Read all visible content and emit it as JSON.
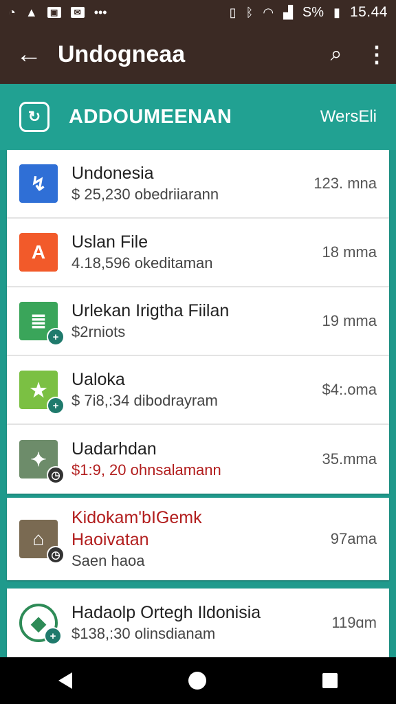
{
  "status": {
    "time": "15.44",
    "battery": "S%"
  },
  "header": {
    "title": "Undogneaa"
  },
  "section": {
    "title": "ADDOUMEENAN",
    "right": "WersEli"
  },
  "list": [
    {
      "title": "Undonesia",
      "subtitle": "$ 25,230 obedriiarann",
      "meta": "123. mna",
      "icon": "messenger-icon",
      "color": "#2f6fd6",
      "glyph": "↯"
    },
    {
      "title": "Uslan File",
      "subtitle": "4.18,596 okeditaman",
      "meta": "18 mma",
      "icon": "letter-a-icon",
      "color": "#f25a2a",
      "glyph": "A"
    },
    {
      "title": "Urlekan Irigtha Fiilan",
      "subtitle": "$2rniots",
      "meta": "19 mma",
      "icon": "sheet-icon",
      "color": "#3aa55a",
      "glyph": "≣"
    },
    {
      "title": "Ualoka",
      "subtitle": "$ 7i8,:34 dibodrayram",
      "meta": "$4:.oma",
      "icon": "star-icon",
      "color": "#7bc043",
      "glyph": "★"
    },
    {
      "title": "Uadarhdan",
      "subtitle": "$1:9, 20 ohnsalamann",
      "meta": "35.mma",
      "icon": "photo-person-icon",
      "color": "#6d8c6a",
      "glyph": "🚶"
    },
    {
      "title": "Kidokam'bIGemk",
      "title2": "Haoivatan",
      "subtitle": "Saen haoa",
      "meta": "97ama",
      "icon": "photo-building-icon",
      "color": "#7a6a52",
      "glyph": "⌂"
    },
    {
      "title": "Hadaolp Ortegh Ildonisia",
      "subtitle": "$138,:30 olinsdianam",
      "meta": "119ɑm",
      "icon": "map-pin-icon",
      "color": "#ffffff",
      "glyph": "◆"
    }
  ]
}
